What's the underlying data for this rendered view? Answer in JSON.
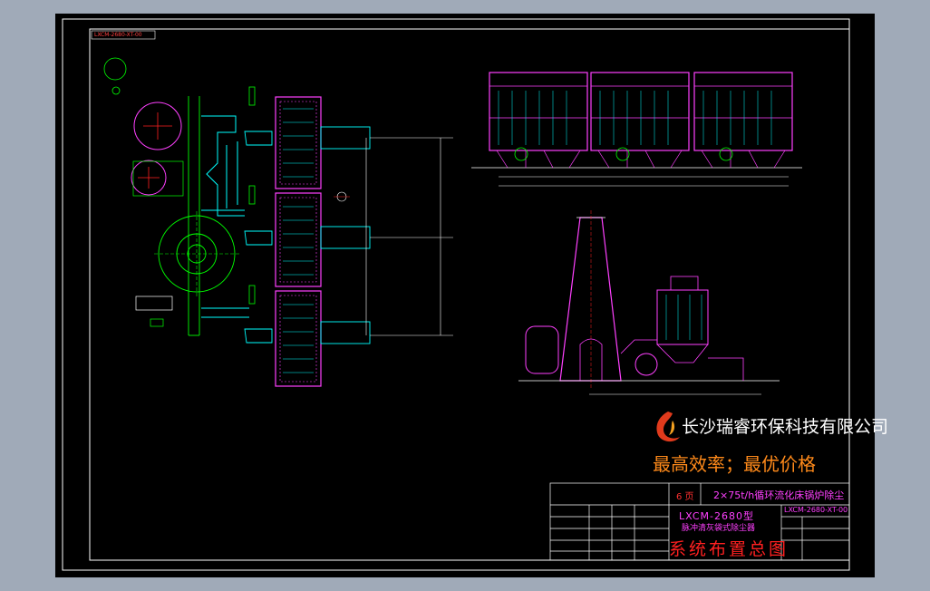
{
  "company": {
    "name": "长沙瑞睿环保科技有限公司",
    "slogan": "最高效率；最优价格"
  },
  "title_block": {
    "sheet_no": "6 页",
    "project": "2×75t/h循环流化床锅炉除尘",
    "model": "LXCM-2680型",
    "description": "脉冲清灰袋式除尘器",
    "title": "系统布置总图",
    "drawing_code": "LXCM-2680-XT-00"
  },
  "corner_tag": "LXCM-2680-XT-00",
  "colors": {
    "background": "#000000",
    "frame": "#ffffff",
    "equipment": "#ff00ff",
    "centerline": "#00ff00",
    "dimension": "#ffffff",
    "duct": "#00ffff",
    "red": "#ff2020"
  }
}
